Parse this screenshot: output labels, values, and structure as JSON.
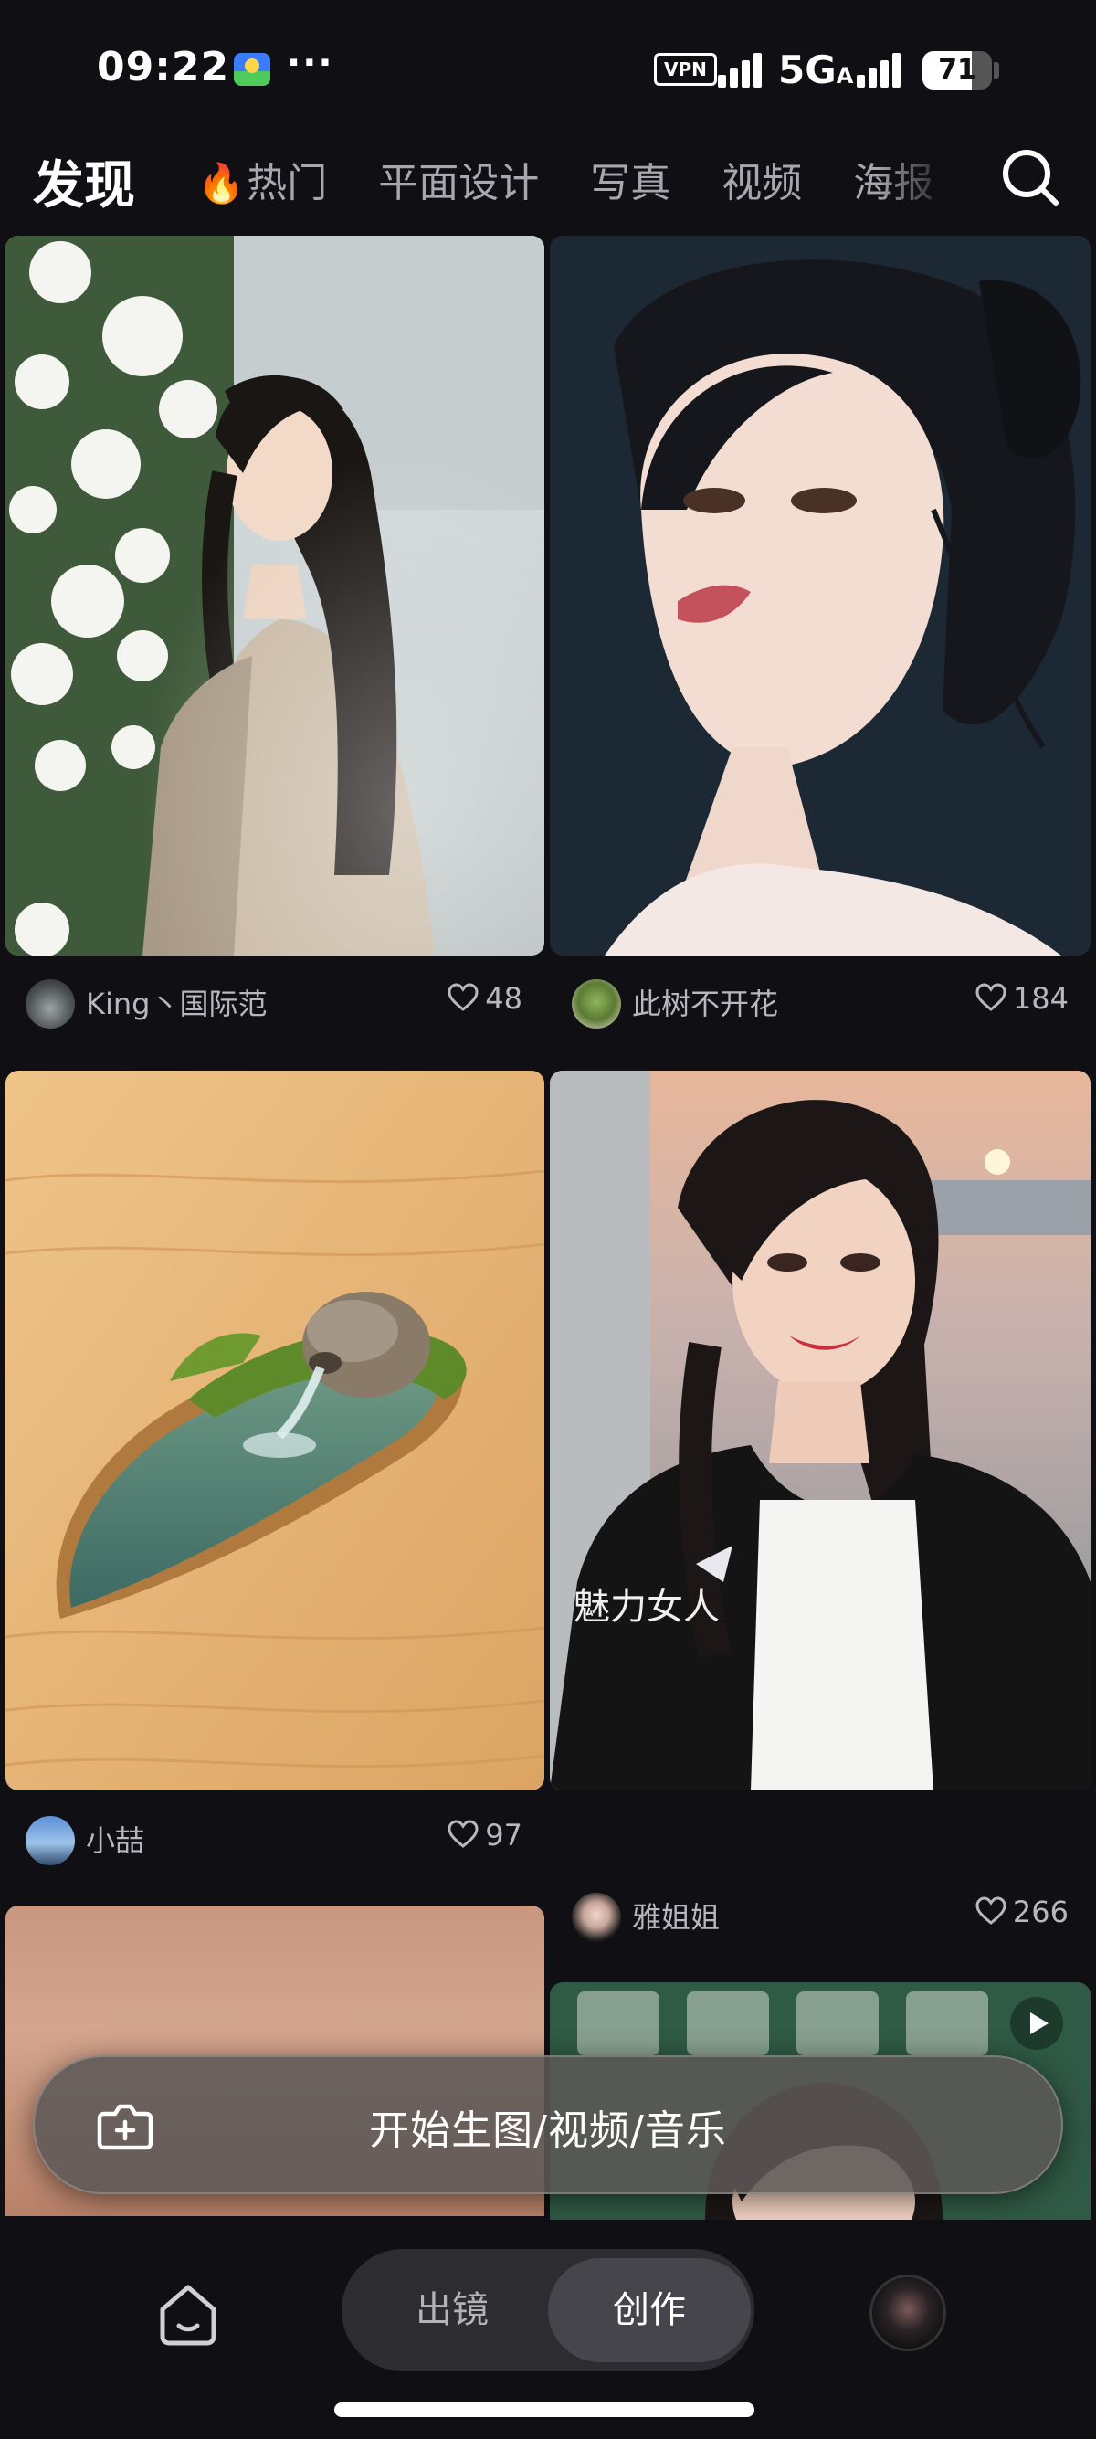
{
  "status_bar": {
    "time": "09:22",
    "more": "···",
    "vpn": "VPN",
    "network": "5G",
    "network_sub": "A",
    "battery": "71",
    "battery_level": 0.71
  },
  "nav": {
    "title": "发现",
    "tabs": [
      {
        "label": "热门",
        "icon": "fire-icon"
      },
      {
        "label": "平面设计"
      },
      {
        "label": "写真"
      },
      {
        "label": "视频"
      },
      {
        "label": "海报"
      }
    ],
    "search_icon": "search-icon"
  },
  "feed": {
    "cards": [
      {
        "author": "King丶国际范",
        "likes": "48"
      },
      {
        "author": "此树不开花",
        "likes": "184"
      },
      {
        "author": "小喆",
        "likes": "97"
      },
      {
        "title": "魅力女人",
        "author": "雅姐姐",
        "likes": "266"
      }
    ]
  },
  "create_bar": {
    "label": "开始生图/视频/音乐",
    "icon": "camera-plus-icon"
  },
  "bottom_nav": {
    "home_icon": "home-icon",
    "segments": [
      "出镜",
      "创作"
    ],
    "active_segment": "创作",
    "profile": "avatar"
  },
  "colors": {
    "background": "#101014",
    "text_secondary": "#b7b7bd",
    "tab_inactive": "#a7a7ad",
    "segment_active": "#45454b"
  }
}
